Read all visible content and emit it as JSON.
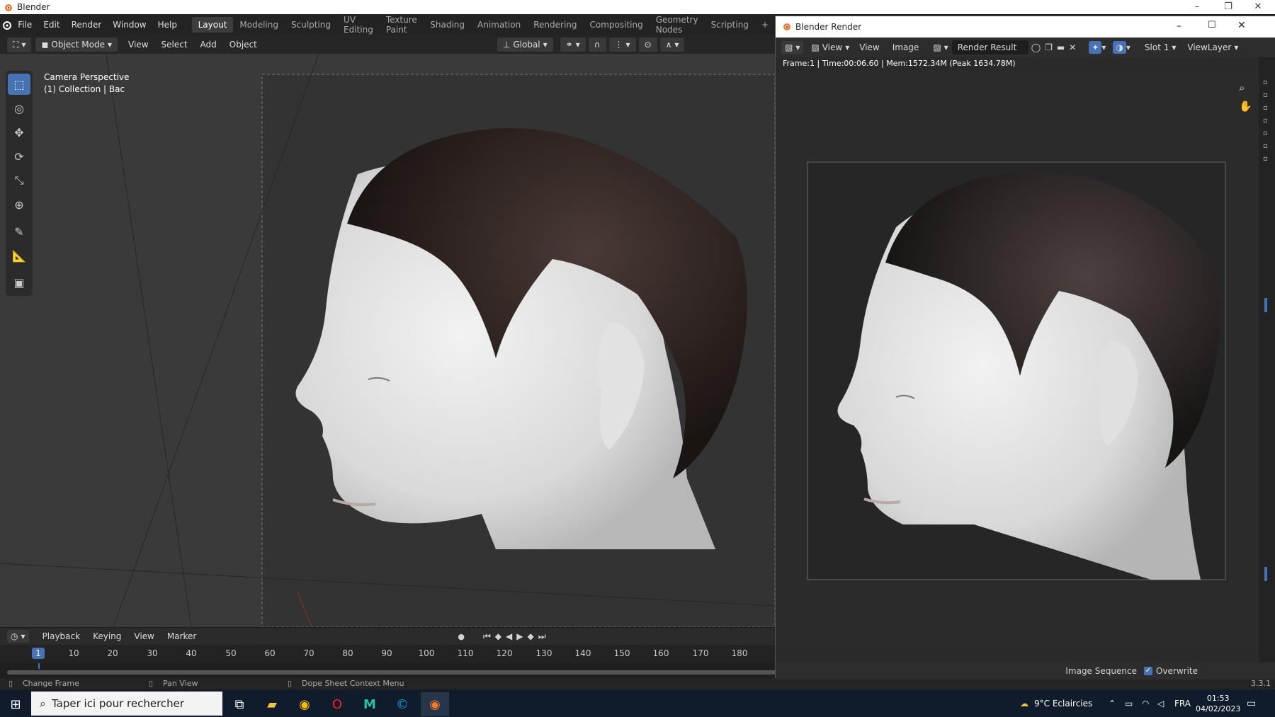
{
  "window": {
    "title": "Blender"
  },
  "menus": [
    "File",
    "Edit",
    "Render",
    "Window",
    "Help"
  ],
  "workspaces": [
    "Layout",
    "Modeling",
    "Sculpting",
    "UV Editing",
    "Texture Paint",
    "Shading",
    "Animation",
    "Rendering",
    "Compositing",
    "Geometry Nodes",
    "Scripting"
  ],
  "workspace_active": "Layout",
  "header": {
    "mode": "Object Mode",
    "menus": [
      "View",
      "Select",
      "Add",
      "Object"
    ],
    "orientation": "Global"
  },
  "viewport": {
    "cam_line1": "Camera Perspective",
    "cam_line2": "(1) Collection | Bac"
  },
  "timeline": {
    "menus": [
      "Playback",
      "Keying",
      "View",
      "Marker"
    ],
    "current_frame": "1",
    "frames": [
      "10",
      "20",
      "30",
      "40",
      "50",
      "60",
      "70",
      "80",
      "90",
      "100",
      "110",
      "120",
      "130",
      "140",
      "150",
      "160",
      "170",
      "180"
    ]
  },
  "status": {
    "item1": "Change Frame",
    "item2": "Pan View",
    "item3": "Dope Sheet Context Menu",
    "version": "3.3.1"
  },
  "render": {
    "title": "Blender Render",
    "menus": [
      "View",
      "View",
      "Image"
    ],
    "result": "Render Result",
    "slot": "Slot 1",
    "layer": "ViewLayer",
    "info": "Frame:1 | Time:00:06.60 | Mem:1572.34M (Peak 1634.78M)",
    "footer_seq": "Image Sequence",
    "footer_overwrite": "Overwrite"
  },
  "taskbar": {
    "search": "Taper ici pour rechercher",
    "weather": "9°C  Eclaircies",
    "lang": "FRA",
    "time": "01:53",
    "date": "04/02/2023"
  }
}
